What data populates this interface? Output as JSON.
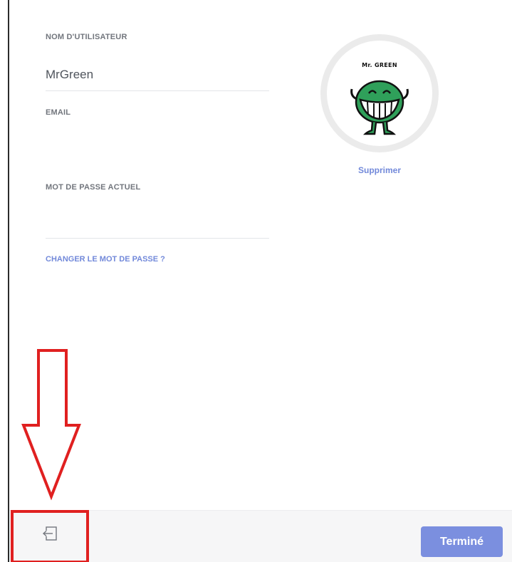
{
  "account": {
    "username_label": "NOM D'UTILISATEUR",
    "username_value": "MrGreen",
    "email_label": "EMAIL",
    "email_value": "",
    "password_label": "MOT DE PASSE ACTUEL",
    "password_value": "",
    "change_password_link": "CHANGER LE MOT DE PASSE ?"
  },
  "avatar": {
    "caption": "Mr. GREEN",
    "remove_label": "Supprimer",
    "icon": "mr-green-character"
  },
  "footer": {
    "logout_icon": "logout-icon",
    "done_label": "Terminé"
  },
  "colors": {
    "accent": "#7289da",
    "button": "#7b8fdf",
    "label": "#72767d",
    "annotation": "#e02020",
    "avatar_green": "#2fa05a"
  }
}
